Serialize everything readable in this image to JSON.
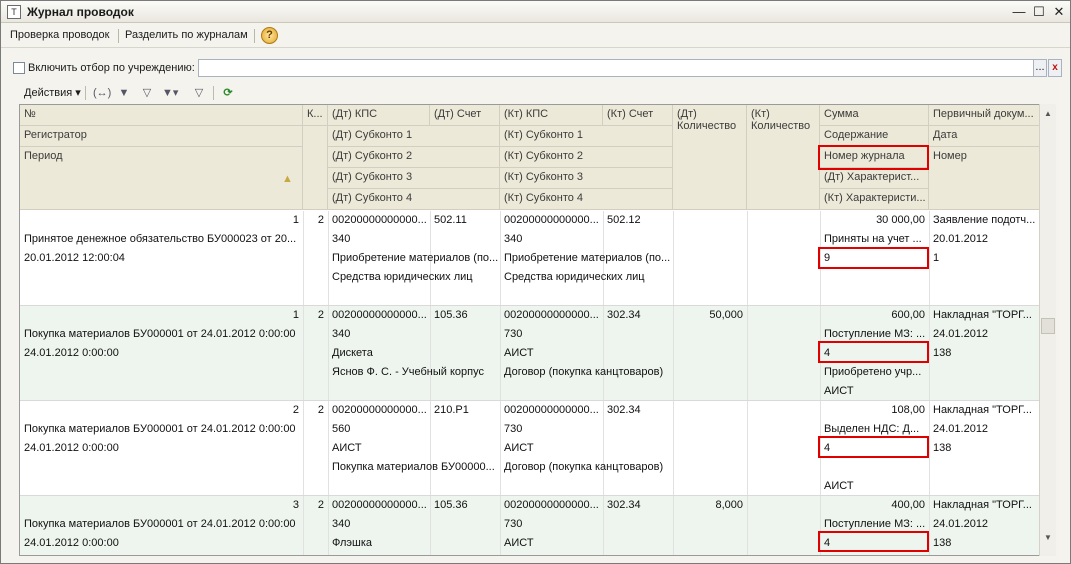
{
  "window": {
    "title": "Журнал проводок",
    "icon_glyph": "Т",
    "minimize": "—",
    "maximize": "☐",
    "close": "✕"
  },
  "commandbar": {
    "check_entries": "Проверка проводок",
    "split_by_journals": "Разделить по журналам",
    "help": "?"
  },
  "filter": {
    "label": "Включить отбор по учреждению:",
    "value": "",
    "select_button": "...",
    "clear_button": "x"
  },
  "table_toolbar": {
    "actions": "Действия ▾",
    "icons": [
      "expand-icon",
      "filter-icon",
      "filter-by-value-icon",
      "filter-history-icon",
      "clear-filter-icon",
      "refresh-icon"
    ]
  },
  "headers": {
    "row1": [
      "№",
      "К...",
      "(Дт) КПС",
      "(Дт) Счет",
      "(Кт) КПС",
      "(Кт) Счет",
      "(Дт) Количество",
      "(Кт) Количество",
      "Сумма",
      "Первичный докум..."
    ],
    "row2": [
      "Регистратор",
      "(Дт) Субконто 1",
      "(Кт) Субконто 1",
      "Содержание",
      "Дата"
    ],
    "row3": [
      "Период",
      "(Дт) Субконто 2",
      "(Кт) Субконто 2",
      "Номер журнала",
      "Номер"
    ],
    "row4": [
      "(Дт) Субконто 3",
      "(Кт) Субконто 3",
      "(Дт) Характерист..."
    ],
    "row5": [
      "(Дт) Субконто 4",
      "(Кт) Субконто 4",
      "(Кт) Характеристи..."
    ]
  },
  "rows": [
    {
      "num": "1",
      "k": "2",
      "registrator": "Принятое денежное обязательство БУ000023 от 20...",
      "period": "20.01.2012 12:00:04",
      "dt_kps": "00200000000000...",
      "dt_account": "502.11",
      "kt_kps": "00200000000000...",
      "kt_account": "502.12",
      "dt_sub1": "340",
      "dt_sub2": "Приобретение материалов (по...",
      "dt_sub3": "Средства юридических лиц",
      "dt_sub4": "",
      "kt_sub1": "340",
      "kt_sub2": "Приобретение материалов (по...",
      "kt_sub3": "Средства юридических лиц",
      "kt_sub4": "",
      "dt_qty": "",
      "kt_qty": "",
      "sum": "30 000,00",
      "content": "Приняты на учет ...",
      "journal": "9",
      "dt_char": "",
      "kt_char": "",
      "doc": "Заявление подотч...",
      "date": "20.01.2012",
      "number": "1"
    },
    {
      "num": "1",
      "k": "2",
      "registrator": "Покупка материалов БУ000001 от 24.01.2012 0:00:00",
      "period": "24.01.2012 0:00:00",
      "dt_kps": "00200000000000...",
      "dt_account": "105.36",
      "kt_kps": "00200000000000...",
      "kt_account": "302.34",
      "dt_sub1": "340",
      "dt_sub2": "Дискета",
      "dt_sub3": "Яснов Ф. С. - Учебный корпус",
      "dt_sub4": "",
      "kt_sub1": "730",
      "kt_sub2": "АИСТ",
      "kt_sub3": "Договор (покупка канцтоваров)",
      "kt_sub4": "",
      "dt_qty": "50,000",
      "kt_qty": "",
      "sum": "600,00",
      "content": "Поступление МЗ: ...",
      "journal": "4",
      "dt_char": "Приобретено учр...",
      "kt_char": "АИСТ",
      "doc": "Накладная \"ТОРГ...",
      "date": "24.01.2012",
      "number": "138"
    },
    {
      "num": "2",
      "k": "2",
      "registrator": "Покупка материалов БУ000001 от 24.01.2012 0:00:00",
      "period": "24.01.2012 0:00:00",
      "dt_kps": "00200000000000...",
      "dt_account": "210.Р1",
      "kt_kps": "00200000000000...",
      "kt_account": "302.34",
      "dt_sub1": "560",
      "dt_sub2": "АИСТ",
      "dt_sub3": "Покупка материалов БУ00000...",
      "dt_sub4": "",
      "kt_sub1": "730",
      "kt_sub2": "АИСТ",
      "kt_sub3": "Договор (покупка канцтоваров)",
      "kt_sub4": "",
      "dt_qty": "",
      "kt_qty": "",
      "sum": "108,00",
      "content": "Выделен НДС: Д...",
      "journal": "4",
      "dt_char": "",
      "kt_char": "АИСТ",
      "doc": "Накладная \"ТОРГ...",
      "date": "24.01.2012",
      "number": "138"
    },
    {
      "num": "3",
      "k": "2",
      "registrator": "Покупка материалов БУ000001 от 24.01.2012 0:00:00",
      "period": "24.01.2012 0:00:00",
      "dt_kps": "00200000000000...",
      "dt_account": "105.36",
      "kt_kps": "00200000000000...",
      "kt_account": "302.34",
      "dt_sub1": "340",
      "dt_sub2": "Флэшка",
      "dt_sub3": "",
      "dt_sub4": "",
      "kt_sub1": "730",
      "kt_sub2": "АИСТ",
      "kt_sub3": "",
      "kt_sub4": "",
      "dt_qty": "8,000",
      "kt_qty": "",
      "sum": "400,00",
      "content": "Поступление МЗ: ...",
      "journal": "4",
      "dt_char": "",
      "kt_char": "",
      "doc": "Накладная \"ТОРГ...",
      "date": "24.01.2012",
      "number": "138"
    }
  ],
  "colors": {
    "highlight": "#e00000",
    "alt_row": "#eef5ee",
    "header_bg": "#ece9d8"
  }
}
